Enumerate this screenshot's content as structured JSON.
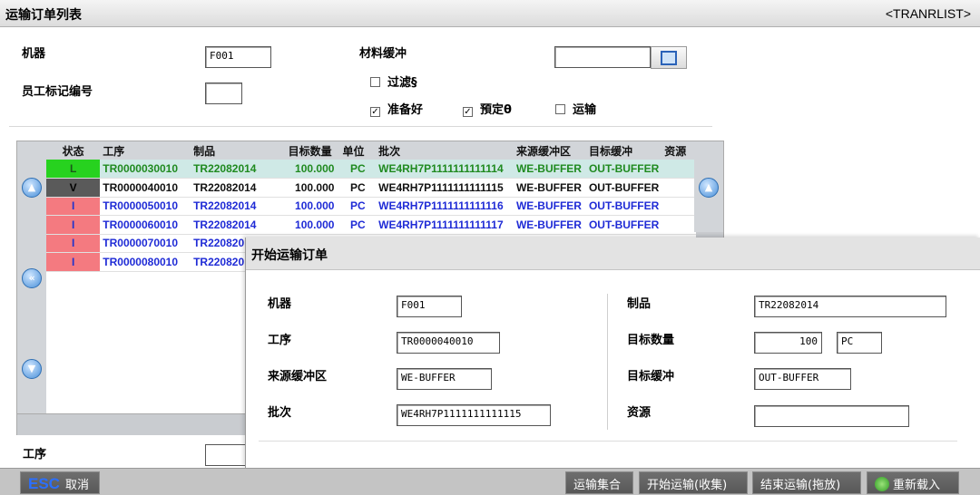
{
  "header": {
    "title": "运输订单列表",
    "code": "<TRANRLIST>"
  },
  "filter": {
    "machine_label": "机器",
    "machine_value": "F001",
    "employee_label": "员工标记编号",
    "employee_value": "",
    "buffer_label": "材料缓冲",
    "buffer_value": "",
    "checkboxes": [
      {
        "label": "过滤§",
        "checked": false
      },
      {
        "label": "准备好",
        "checked": true
      },
      {
        "label": "預定θ",
        "checked": true
      },
      {
        "label": "运输",
        "checked": false
      }
    ]
  },
  "grid": {
    "columns": [
      "状态",
      "工序",
      "制品",
      "目标数量",
      "单位",
      "批次",
      "来源缓冲区",
      "目标缓冲",
      "资源"
    ],
    "rows": [
      {
        "status": "L",
        "op": "TR0000030010",
        "product": "TR22082014",
        "qty": "100.000",
        "unit": "PC",
        "lot": "WE4RH7P1111111111114",
        "src": "WE-BUFFER",
        "dst": "OUT-BUFFER",
        "res": "",
        "status_bg": "#27d21f",
        "status_fg": "#1a5a1a",
        "text_color": "#1f8a1f",
        "row_bg": "#cfe9e6"
      },
      {
        "status": "V",
        "op": "TR0000040010",
        "product": "TR22082014",
        "qty": "100.000",
        "unit": "PC",
        "lot": "WE4RH7P1111111111115",
        "src": "WE-BUFFER",
        "dst": "OUT-BUFFER",
        "res": "",
        "status_bg": "#5a5a5a",
        "status_fg": "#000000",
        "text_color": "#111111",
        "row_bg": "#ffffff"
      },
      {
        "status": "I",
        "op": "TR0000050010",
        "product": "TR22082014",
        "qty": "100.000",
        "unit": "PC",
        "lot": "WE4RH7P1111111111116",
        "src": "WE-BUFFER",
        "dst": "OUT-BUFFER",
        "res": "",
        "status_bg": "#f47a80",
        "status_fg": "#2233cc",
        "text_color": "#1f2bd6",
        "row_bg": "#ffffff"
      },
      {
        "status": "I",
        "op": "TR0000060010",
        "product": "TR22082014",
        "qty": "100.000",
        "unit": "PC",
        "lot": "WE4RH7P1111111111117",
        "src": "WE-BUFFER",
        "dst": "OUT-BUFFER",
        "res": "",
        "status_bg": "#f47a80",
        "status_fg": "#2233cc",
        "text_color": "#1f2bd6",
        "row_bg": "#ffffff"
      },
      {
        "status": "I",
        "op": "TR0000070010",
        "product": "TR220820",
        "qty": "",
        "unit": "",
        "lot": "",
        "src": "",
        "dst": "",
        "res": "",
        "status_bg": "#f47a80",
        "status_fg": "#2233cc",
        "text_color": "#1f2bd6",
        "row_bg": "#ffffff"
      },
      {
        "status": "I",
        "op": "TR0000080010",
        "product": "TR220820",
        "qty": "",
        "unit": "",
        "lot": "",
        "src": "",
        "dst": "",
        "res": "",
        "status_bg": "#f47a80",
        "status_fg": "#2233cc",
        "text_color": "#1f2bd6",
        "row_bg": "#ffffff"
      }
    ]
  },
  "bottom": {
    "op_label": "工序"
  },
  "dialog": {
    "title": "开始运输订单",
    "machine_label": "机器",
    "machine_value": "F001",
    "op_label": "工序",
    "op_value": "TR0000040010",
    "src_label": "来源缓冲区",
    "src_value": "WE-BUFFER",
    "lot_label": "批次",
    "lot_value": "WE4RH7P1111111111115",
    "product_label": "制品",
    "product_value": "TR22082014",
    "qty_label": "目标数量",
    "qty_value": "100",
    "unit_value": "PC",
    "dst_label": "目标缓冲",
    "dst_value": "OUT-BUFFER",
    "res_label": "资源",
    "res_value": ""
  },
  "statusbar": {
    "esc_key": "ESC",
    "esc_label": "取消",
    "btn_collect": "运输集合",
    "btn_start": "开始运输(收集)",
    "btn_end": "结束运输(拖放)",
    "btn_reload": "重新载入"
  }
}
